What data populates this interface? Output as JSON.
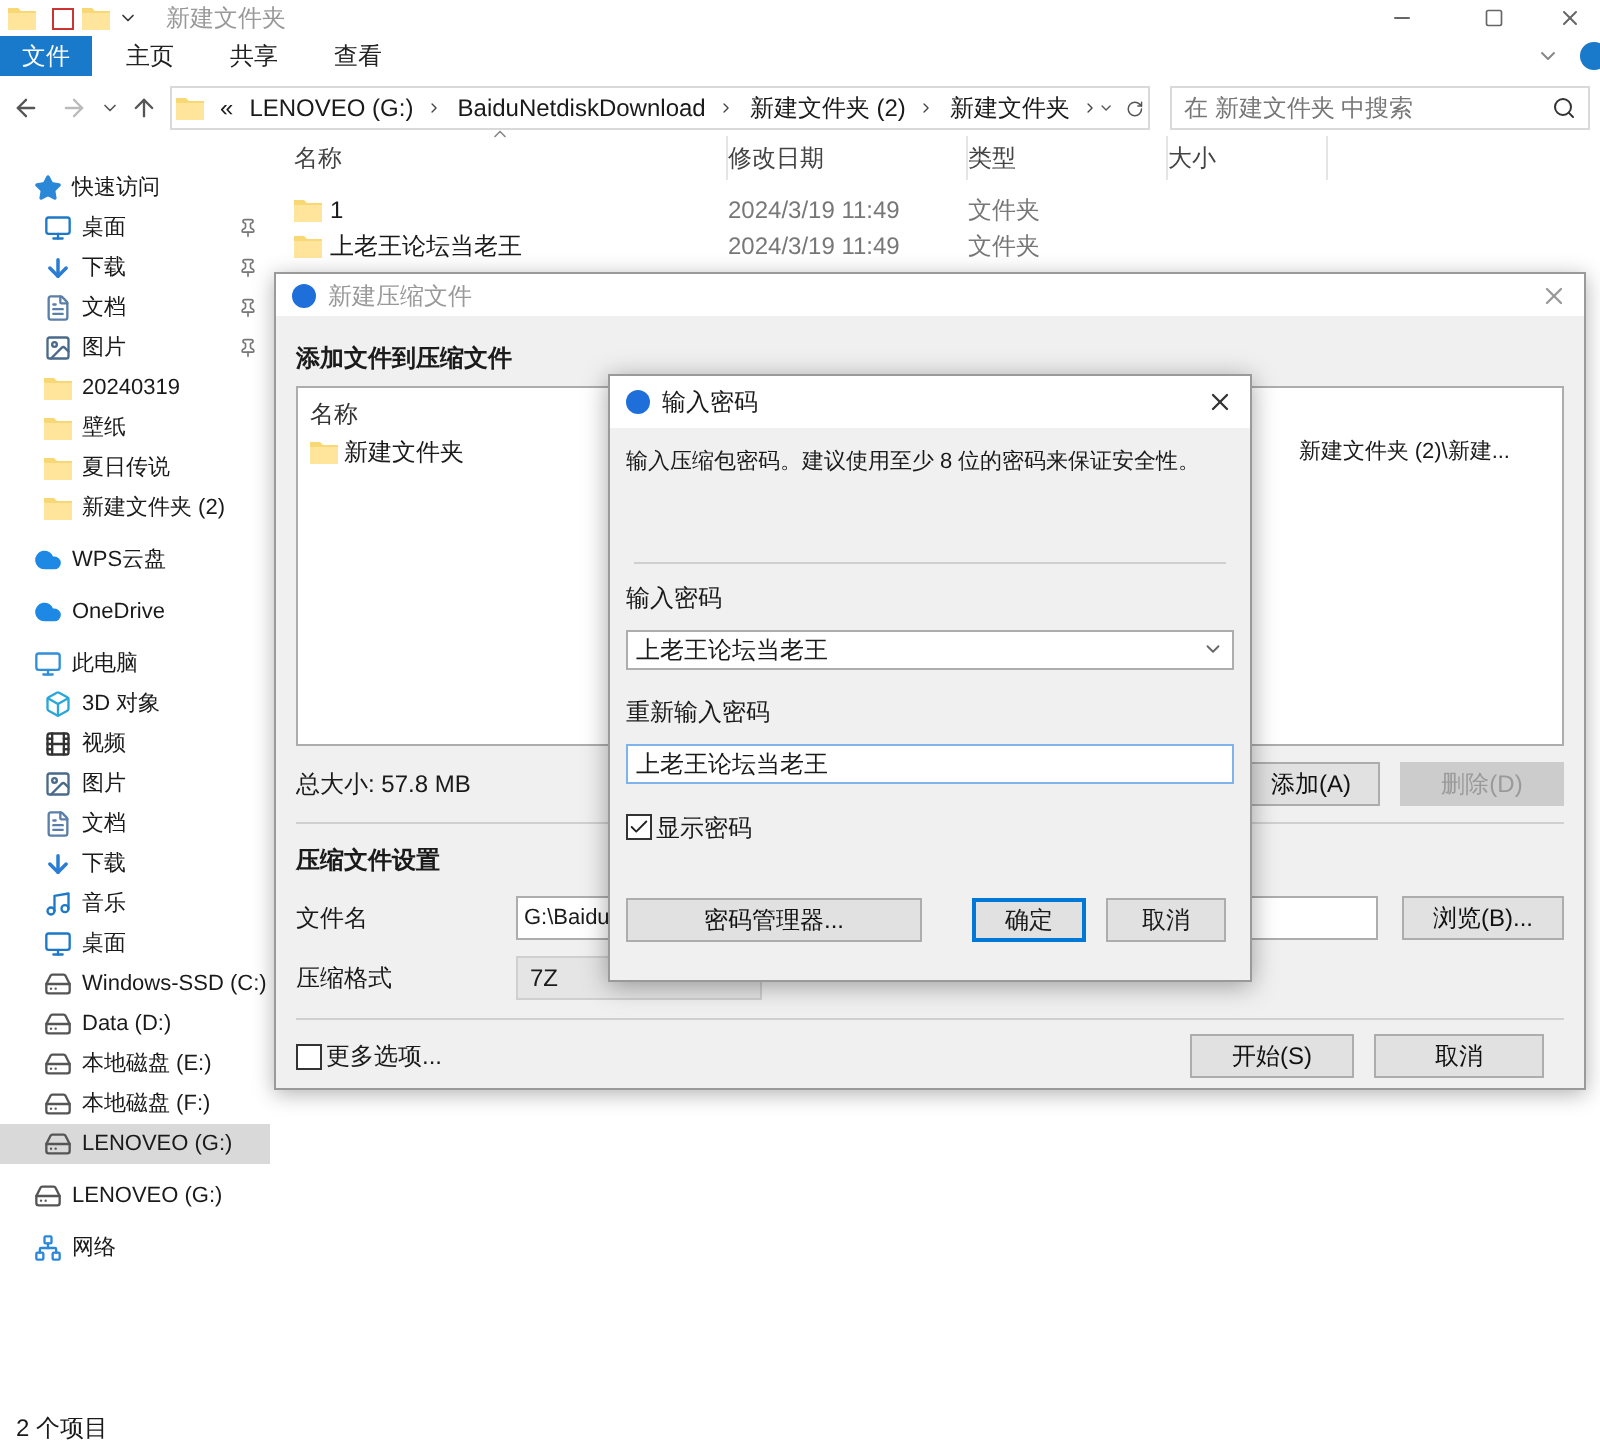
{
  "explorer": {
    "title": "新建文件夹",
    "ribbon_tabs": [
      {
        "label": "文件",
        "selected": true
      },
      {
        "label": "主页",
        "selected": false
      },
      {
        "label": "共享",
        "selected": false
      },
      {
        "label": "查看",
        "selected": false
      }
    ],
    "address": {
      "overflow": "«",
      "crumbs": [
        "LENOVEO (G:)",
        "BaiduNetdiskDownload",
        "新建文件夹 (2)",
        "新建文件夹"
      ]
    },
    "search": {
      "placeholder": "在 新建文件夹 中搜索"
    },
    "columns": [
      "名称",
      "修改日期",
      "类型",
      "大小"
    ],
    "rows": [
      {
        "name": "1",
        "date": "2024/3/19 11:49",
        "type": "文件夹"
      },
      {
        "name": "上老王论坛当老王",
        "date": "2024/3/19 11:49",
        "type": "文件夹"
      }
    ],
    "sidebar": [
      {
        "label": "快速访问",
        "kind": "star",
        "selected": false,
        "children": [
          {
            "label": "桌面",
            "kind": "desktop",
            "pinned": true,
            "selected": false
          },
          {
            "label": "下载",
            "kind": "download",
            "pinned": true,
            "selected": false
          },
          {
            "label": "文档",
            "kind": "document",
            "pinned": true,
            "selected": false
          },
          {
            "label": "图片",
            "kind": "picture",
            "pinned": true,
            "selected": false
          },
          {
            "label": "20240319",
            "kind": "folder",
            "pinned": false,
            "selected": false
          },
          {
            "label": "壁纸",
            "kind": "folder",
            "pinned": false,
            "selected": false
          },
          {
            "label": "夏日传说",
            "kind": "folder",
            "pinned": false,
            "selected": false
          },
          {
            "label": "新建文件夹 (2)",
            "kind": "folder",
            "pinned": false,
            "selected": false
          }
        ]
      },
      {
        "label": "WPS云盘",
        "kind": "cloud",
        "selected": false
      },
      {
        "label": "OneDrive",
        "kind": "cloud",
        "selected": false
      },
      {
        "label": "此电脑",
        "kind": "pc",
        "selected": false,
        "children": [
          {
            "label": "3D 对象",
            "kind": "cube",
            "pinned": false,
            "selected": false
          },
          {
            "label": "视频",
            "kind": "video",
            "pinned": false,
            "selected": false
          },
          {
            "label": "图片",
            "kind": "picture",
            "pinned": false,
            "selected": false
          },
          {
            "label": "文档",
            "kind": "document",
            "pinned": false,
            "selected": false
          },
          {
            "label": "下载",
            "kind": "download",
            "pinned": false,
            "selected": false
          },
          {
            "label": "音乐",
            "kind": "music",
            "pinned": false,
            "selected": false
          },
          {
            "label": "桌面",
            "kind": "desktop",
            "pinned": false,
            "selected": false
          },
          {
            "label": "Windows-SSD (C:)",
            "kind": "drive",
            "pinned": false,
            "selected": false
          },
          {
            "label": "Data (D:)",
            "kind": "drive",
            "pinned": false,
            "selected": false
          },
          {
            "label": "本地磁盘 (E:)",
            "kind": "drive",
            "pinned": false,
            "selected": false
          },
          {
            "label": "本地磁盘 (F:)",
            "kind": "drive",
            "pinned": false,
            "selected": false
          },
          {
            "label": "LENOVEO (G:)",
            "kind": "drive",
            "pinned": false,
            "selected": true
          }
        ]
      },
      {
        "label": "LENOVEO (G:)",
        "kind": "drive",
        "selected": false
      },
      {
        "label": "网络",
        "kind": "network",
        "selected": false
      }
    ],
    "status_bar": "2 个项目"
  },
  "compress_dialog": {
    "title": "新建压缩文件",
    "section": "添加文件到压缩文件",
    "list_header": "名称",
    "list_rows": [
      {
        "name": "新建文件夹",
        "path": "新建文件夹 (2)\\新建..."
      }
    ],
    "total": "总大小: 57.8 MB",
    "add_button": {
      "label": "添加(A)",
      "disabled": false
    },
    "delete_button": {
      "label": "删除(D)",
      "disabled": true
    },
    "settings_title": "压缩文件设置",
    "filename_label": "文件名",
    "filename_value": "G:\\Baidu",
    "browse_button": "浏览(B)...",
    "format_label": "压缩格式",
    "format_value": "7Z",
    "more_options": {
      "label": "更多选项...",
      "checked": false
    },
    "start_button": "开始(S)",
    "cancel_button": "取消"
  },
  "password_dialog": {
    "title": "输入密码",
    "description": "输入压缩包密码。建议使用至少 8 位的密码来保证安全性。",
    "password_label": "输入密码",
    "password_value": "上老王论坛当老王",
    "confirm_label": "重新输入密码",
    "confirm_value": "上老王论坛当老王",
    "show_password": {
      "label": "显示密码",
      "checked": true
    },
    "manager_button": "密码管理器...",
    "buttons": [
      {
        "label": "确定",
        "default": true
      },
      {
        "label": "取消",
        "default": false
      }
    ]
  }
}
